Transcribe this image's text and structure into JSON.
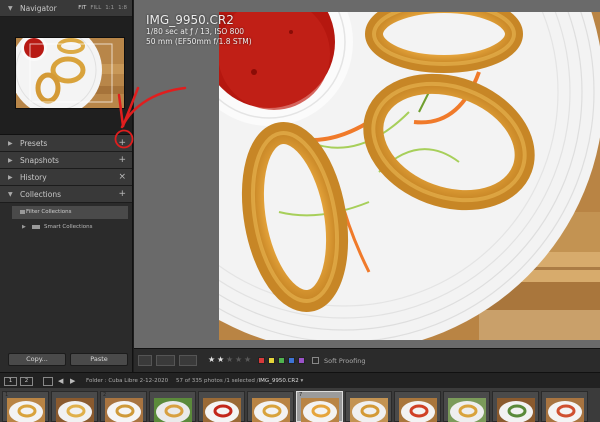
{
  "left_panel": {
    "navigator": {
      "title": "Navigator",
      "zoom_options": [
        "FIT",
        "FILL",
        "1:1",
        "1:8"
      ],
      "active_zoom": "FIT"
    },
    "presets": {
      "title": "Presets",
      "action": "+"
    },
    "snapshots": {
      "title": "Snapshots",
      "action": "+"
    },
    "history": {
      "title": "History",
      "action": "×"
    },
    "collections": {
      "title": "Collections",
      "action": "+",
      "items": [
        {
          "label": "Filter Collections",
          "selected": true
        },
        {
          "label": "Smart Collections",
          "selected": false
        }
      ]
    },
    "copy_label": "Copy...",
    "paste_label": "Paste"
  },
  "viewer": {
    "filename": "IMG_9950.CR2",
    "exposure": "1/80 sec at ƒ / 13, ISO 800",
    "lens": "50 mm (EF50mm f/1.8 STM)"
  },
  "toolbar": {
    "soft_proofing_label": "Soft Proofing",
    "rating_stars": 2,
    "max_stars": 5,
    "color_labels": [
      "#d83a3a",
      "#e5d43a",
      "#4fb34f",
      "#3d74d6",
      "#9a52c8"
    ]
  },
  "filmstrip": {
    "screen_buttons": [
      "1",
      "2"
    ],
    "folder_text": "Folder : Cuba Libre 2-12-2020",
    "count_text": "57 of 335 photos /1 selected /",
    "selected_file": "IMG_9950.CR2",
    "thumbnails": [
      {
        "num": "1"
      },
      {
        "num": ""
      },
      {
        "num": "2"
      },
      {
        "num": ""
      },
      {
        "num": ""
      },
      {
        "num": ""
      },
      {
        "num": "7"
      },
      {
        "num": ""
      },
      {
        "num": ""
      },
      {
        "num": ""
      },
      {
        "num": ""
      },
      {
        "num": ""
      }
    ],
    "selected_index": 6
  },
  "annotation": {
    "color": "#e01e1e"
  }
}
